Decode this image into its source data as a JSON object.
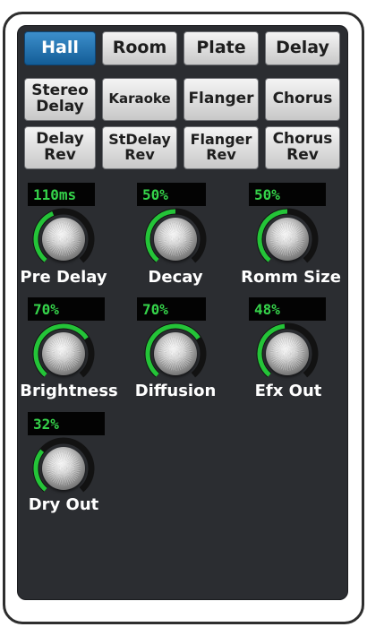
{
  "colors": {
    "panel": "#2b2d31",
    "accent": "#1e6fb0",
    "lcd_text": "#35d34a",
    "arc": "#24c438",
    "arc_track": "#121212"
  },
  "effect_buttons": [
    {
      "label": "Hall",
      "active": true
    },
    {
      "label": "Room",
      "active": false
    },
    {
      "label": "Plate",
      "active": false
    },
    {
      "label": "Delay",
      "active": false
    },
    {
      "label": "Stereo\nDelay",
      "active": false
    },
    {
      "label": "Karaoke",
      "active": false
    },
    {
      "label": "Flanger",
      "active": false
    },
    {
      "label": "Chorus",
      "active": false
    },
    {
      "label": "Delay\nRev",
      "active": false
    },
    {
      "label": "StDelay\nRev",
      "active": false
    },
    {
      "label": "Flanger\nRev",
      "active": false
    },
    {
      "label": "Chorus\nRev",
      "active": false
    }
  ],
  "knobs": [
    {
      "label": "Pre Delay",
      "value": "110ms",
      "level": 0.42
    },
    {
      "label": "Decay",
      "value": "50%",
      "level": 0.5
    },
    {
      "label": "Romm Size",
      "value": "50%",
      "level": 0.5
    },
    {
      "label": "Brightness",
      "value": "70%",
      "level": 0.7
    },
    {
      "label": "Diffusion",
      "value": "70%",
      "level": 0.7
    },
    {
      "label": "Efx Out",
      "value": "48%",
      "level": 0.48
    },
    {
      "label": "Dry Out",
      "value": "32%",
      "level": 0.32
    }
  ]
}
